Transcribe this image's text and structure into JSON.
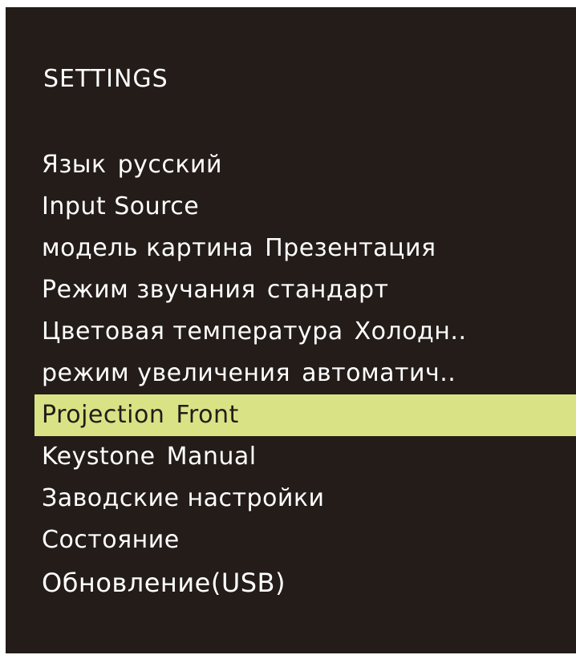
{
  "title": "SETTINGS",
  "colors": {
    "background": "#231c19",
    "text": "#ffffff",
    "highlight": "#d9e386",
    "highlight_text": "#231c19",
    "frame": "#ffffff"
  },
  "menu": {
    "items": [
      {
        "label": "Язык",
        "value": "русский"
      },
      {
        "label": "Input Source",
        "value": ""
      },
      {
        "label": "модель картина",
        "value": "Презентация"
      },
      {
        "label": "Режим звучания",
        "value": "стандарт"
      },
      {
        "label": "Цветовая температура",
        "value": "Холодн.."
      },
      {
        "label": "режим увеличения",
        "value": "автоматич.."
      },
      {
        "label": "Projection",
        "value": "Front",
        "selected": true
      },
      {
        "label": "Keystone",
        "value": "Manual"
      },
      {
        "label": "Заводские настройки",
        "value": ""
      },
      {
        "label": "Состояние",
        "value": ""
      },
      {
        "label": "Обновление(USB)",
        "value": ""
      }
    ]
  }
}
